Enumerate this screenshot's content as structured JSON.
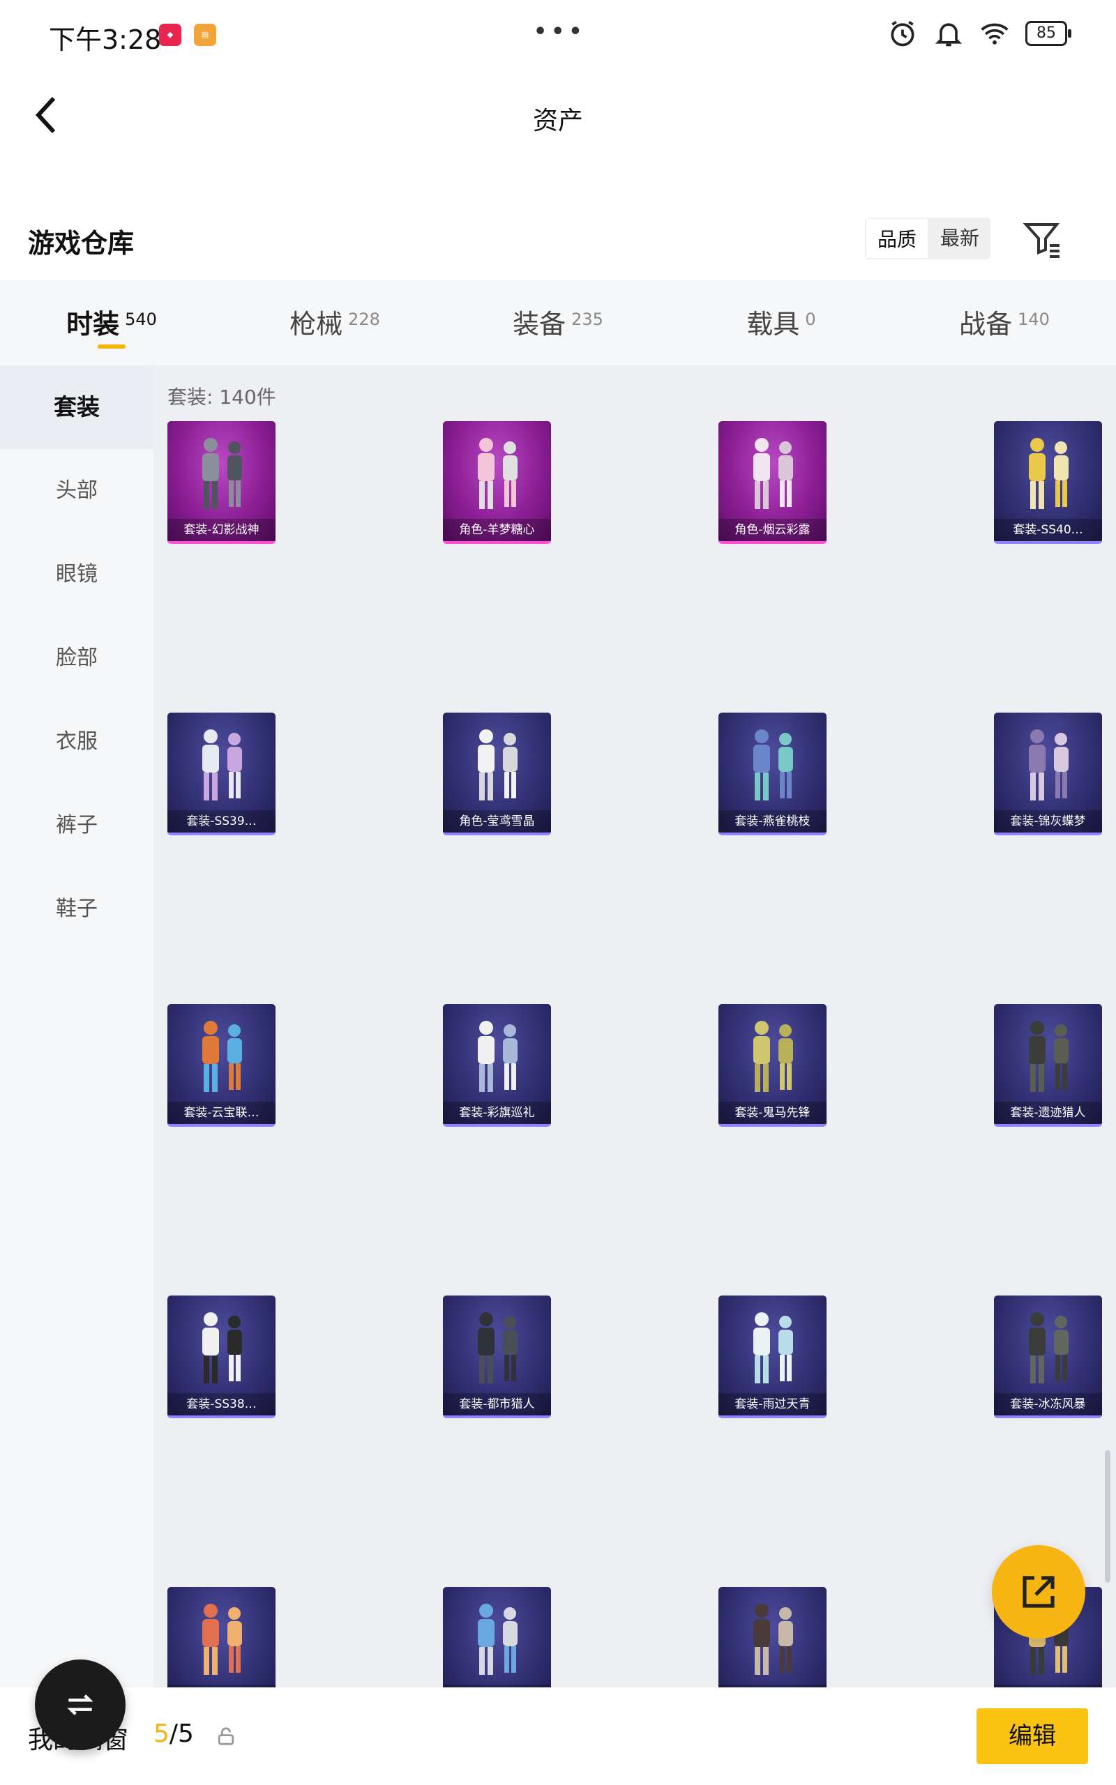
{
  "status_bar": {
    "time": "下午3:28",
    "battery": "85"
  },
  "header": {
    "title": "资产"
  },
  "section": {
    "title": "游戏仓库",
    "sort_quality": "品质",
    "sort_latest": "最新"
  },
  "tabs": [
    {
      "label": "时装",
      "count": "540",
      "active": true
    },
    {
      "label": "枪械",
      "count": "228"
    },
    {
      "label": "装备",
      "count": "235"
    },
    {
      "label": "载具",
      "count": "0"
    },
    {
      "label": "战备",
      "count": "140"
    }
  ],
  "sidebar": [
    {
      "label": "套装",
      "active": true
    },
    {
      "label": "头部"
    },
    {
      "label": "眼镜"
    },
    {
      "label": "脸部"
    },
    {
      "label": "衣服"
    },
    {
      "label": "裤子"
    },
    {
      "label": "鞋子"
    }
  ],
  "grid": {
    "count_label": "套装: 140件",
    "items": [
      {
        "name": "套装-幻影战神",
        "rarity": "legend"
      },
      {
        "name": "角色-羊梦糖心",
        "rarity": "legend"
      },
      {
        "name": "角色-烟云彩露",
        "rarity": "legend"
      },
      {
        "name": "套装-SS40…",
        "rarity": "epic"
      },
      {
        "name": "套装-SS39…",
        "rarity": "epic"
      },
      {
        "name": "角色-莹鸢雪晶",
        "rarity": "epic"
      },
      {
        "name": "套装-燕雀桃枝",
        "rarity": "epic"
      },
      {
        "name": "套装-锦灰蝶梦",
        "rarity": "epic"
      },
      {
        "name": "套装-云宝联…",
        "rarity": "epic"
      },
      {
        "name": "套装-彩旗巡礼",
        "rarity": "epic"
      },
      {
        "name": "套装-鬼马先锋",
        "rarity": "epic"
      },
      {
        "name": "套装-遗迹猎人",
        "rarity": "epic"
      },
      {
        "name": "套装-SS38…",
        "rarity": "epic"
      },
      {
        "name": "套装-都市猎人",
        "rarity": "epic"
      },
      {
        "name": "套装-雨过天青",
        "rarity": "epic"
      },
      {
        "name": "套装-冰冻风暴",
        "rarity": "epic"
      },
      {
        "name": "",
        "rarity": "epic"
      },
      {
        "name": "",
        "rarity": "epic"
      },
      {
        "name": "",
        "rarity": "epic"
      },
      {
        "name": "",
        "rarity": "epic"
      }
    ]
  },
  "bottom_bar": {
    "showcase_label": "我的橱窗",
    "showcase_current": "5",
    "showcase_total": "/5",
    "edit_label": "编辑"
  },
  "colors": {
    "accent": "#f5b50a",
    "legend": "#8d1f96",
    "epic": "#2f2e70"
  }
}
